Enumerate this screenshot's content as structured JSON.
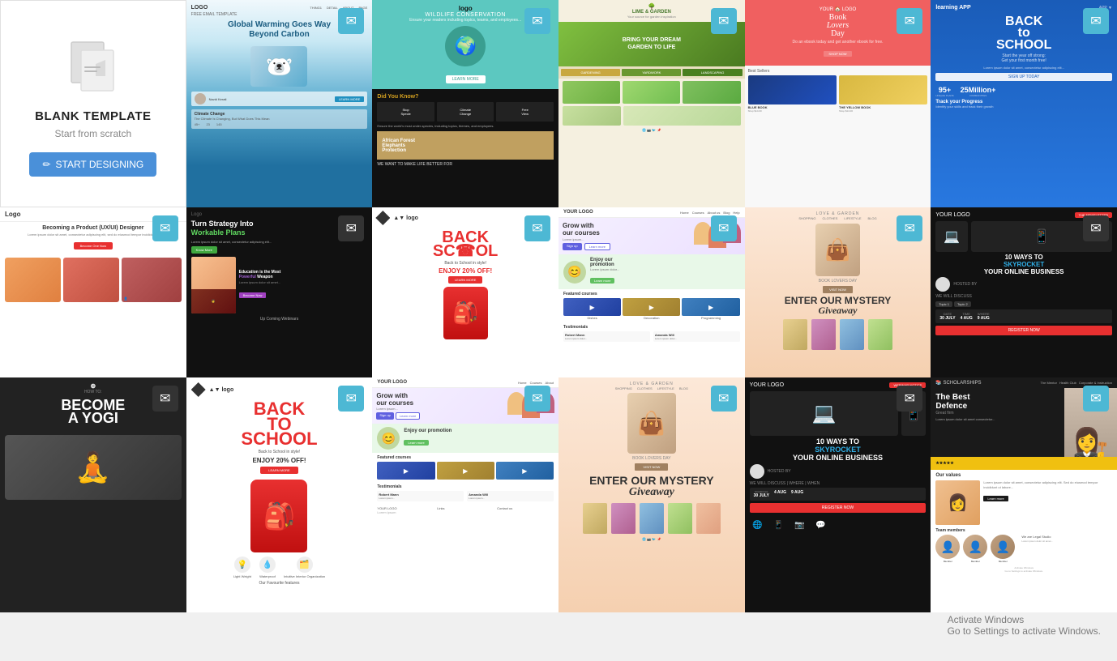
{
  "blank_template": {
    "title": "BLANK TEMPLATE",
    "subtitle": "Start from scratch",
    "start_btn": "START DESIGNING"
  },
  "watermark": {
    "line1": "Activate Windows",
    "line2": "Go to Settings to activate Windows."
  },
  "mail_icon": "✉",
  "pencil_icon": "✏",
  "templates": [
    {
      "id": "blank",
      "type": "blank"
    },
    {
      "id": "global-warming",
      "color_top": "#e8f4f8",
      "color_bottom": "#2070a0",
      "title": "Global Warming Goes Way Beyond Carbon"
    },
    {
      "id": "wildlife",
      "color_top": "#5cc8c0",
      "color_bottom": "#111",
      "title": "Wildlife Conservation"
    },
    {
      "id": "garden",
      "color_top": "#f5f0e0",
      "color_bottom": "#4a7a30",
      "title": "Bring Your Dream Garden to Life"
    },
    {
      "id": "book-lovers-red",
      "color": "#f06060",
      "title": "Book Lovers Day"
    },
    {
      "id": "back-school-blue",
      "color": "#1a5cb8",
      "title": "Back to School"
    },
    {
      "id": "ux-designer",
      "color": "#ffffff",
      "title": "Becoming a Product (UX/UI) Designer"
    },
    {
      "id": "strategy",
      "color": "#111111",
      "title": "Turn Strategy Into Workable Plans"
    },
    {
      "id": "back-school-white",
      "color": "#ffffff",
      "title": "Back to School"
    },
    {
      "id": "courses",
      "color": "#ffffff",
      "title": "Grow with our courses"
    },
    {
      "id": "book-lovers-day-peach",
      "color": "#fce8d8",
      "title": "Book Lovers Day"
    },
    {
      "id": "skyrocket",
      "color": "#111111",
      "title": "10 Ways to Skyrocket Your Online Business"
    },
    {
      "id": "defence",
      "color": "#ffffff",
      "title": "The Best Defence"
    },
    {
      "id": "become-yogi",
      "color": "#222222",
      "title": "Become a Yogi"
    },
    {
      "id": "back-school-red2",
      "color": "#e83030",
      "title": "Back to School"
    }
  ]
}
